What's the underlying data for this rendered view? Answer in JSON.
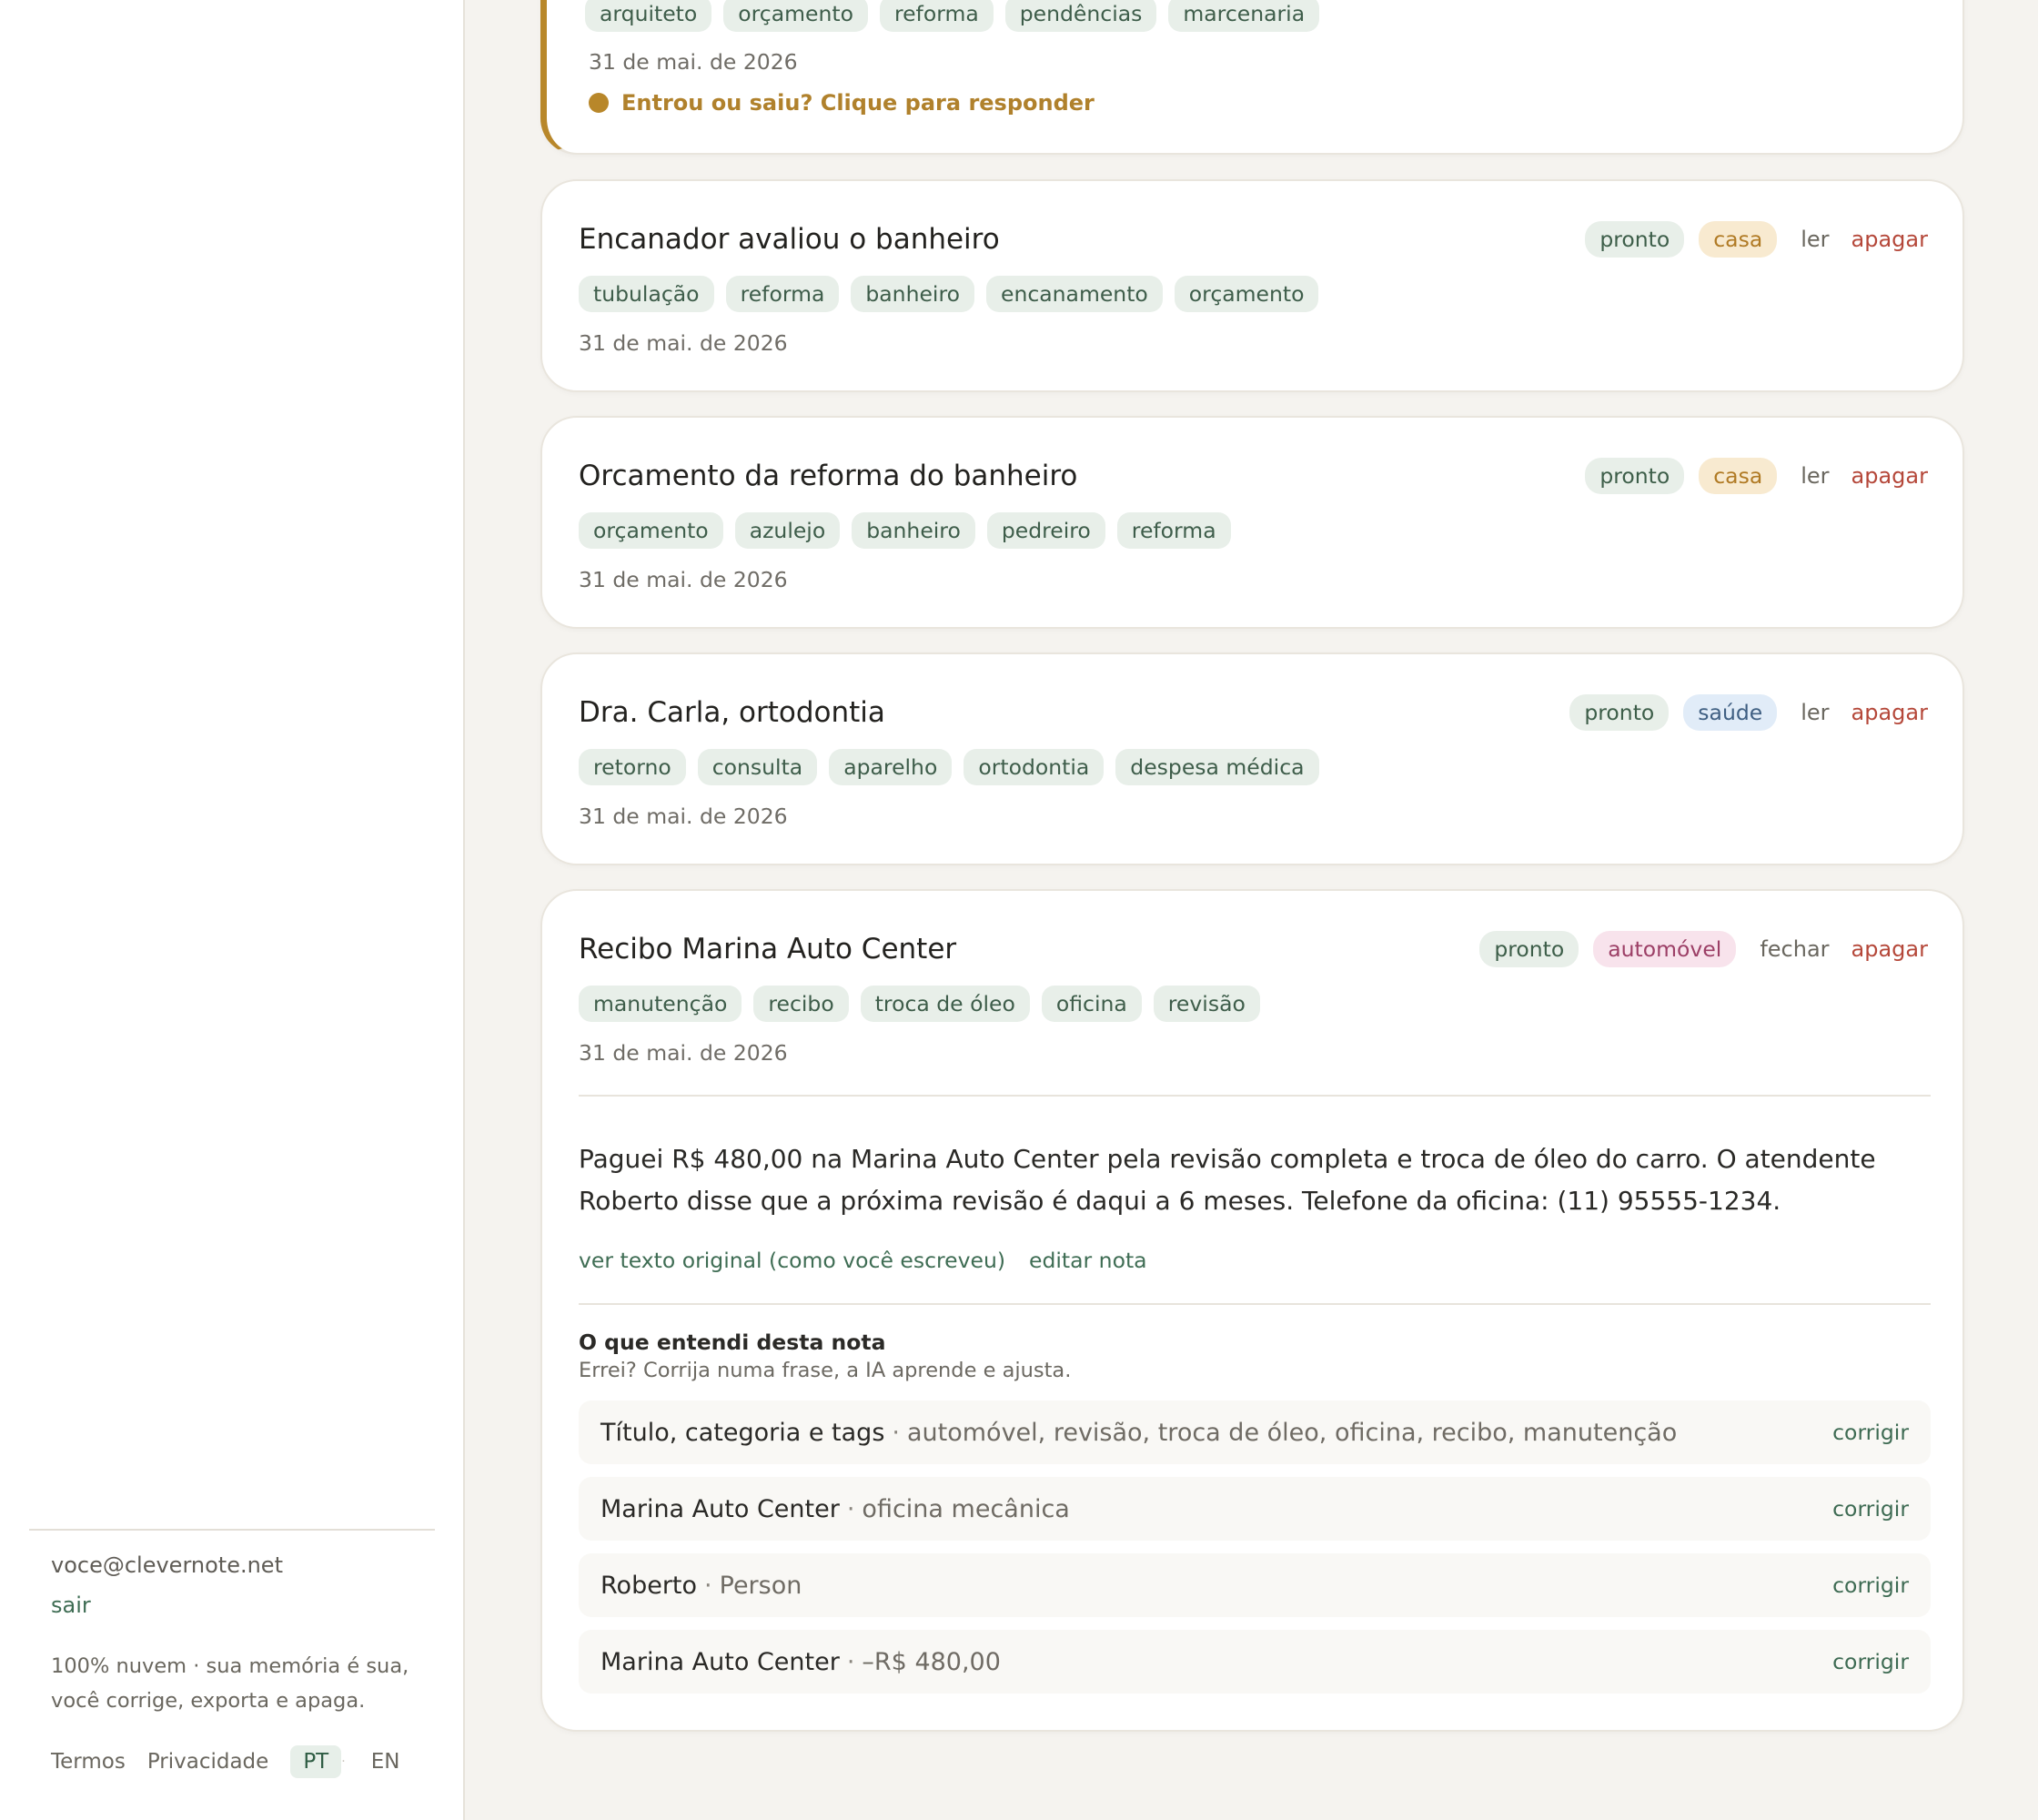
{
  "sidebar": {
    "email": "voce@clevernote.net",
    "signout": "sair",
    "tagline": "100% nuvem · sua memória é sua, você corrige, exporta e apaga.",
    "links": {
      "terms": "Termos",
      "privacy": "Privacidade"
    },
    "lang": {
      "pt": "PT",
      "sep": "·",
      "en": "EN",
      "active": "PT"
    }
  },
  "notes": {
    "pending": {
      "tags": [
        "arquiteto",
        "orçamento",
        "reforma",
        "pendências",
        "marcenaria"
      ],
      "date": "31 de mai. de 2026",
      "prompt": "Entrou ou saiu? Clique para responder"
    },
    "n1": {
      "title": "Encanador avaliou o banheiro",
      "status": "pronto",
      "category": "casa",
      "read": "ler",
      "delete": "apagar",
      "tags": [
        "tubulação",
        "reforma",
        "banheiro",
        "encanamento",
        "orçamento"
      ],
      "date": "31 de mai. de 2026"
    },
    "n2": {
      "title": "Orcamento da reforma do banheiro",
      "status": "pronto",
      "category": "casa",
      "read": "ler",
      "delete": "apagar",
      "tags": [
        "orçamento",
        "azulejo",
        "banheiro",
        "pedreiro",
        "reforma"
      ],
      "date": "31 de mai. de 2026"
    },
    "n3": {
      "title": "Dra. Carla, ortodontia",
      "status": "pronto",
      "category": "saúde",
      "read": "ler",
      "delete": "apagar",
      "tags": [
        "retorno",
        "consulta",
        "aparelho",
        "ortodontia",
        "despesa médica"
      ],
      "date": "31 de mai. de 2026"
    },
    "n4": {
      "title": "Recibo Marina Auto Center",
      "status": "pronto",
      "category": "automóvel",
      "close": "fechar",
      "delete": "apagar",
      "tags": [
        "manutenção",
        "recibo",
        "troca de óleo",
        "oficina",
        "revisão"
      ],
      "date": "31 de mai. de 2026",
      "body": "Paguei R$ 480,00 na Marina Auto Center pela revisão completa e troca de óleo do carro. O atendente Roberto disse que a próxima revisão é daqui a 6 meses. Telefone da oficina: (11) 95555-1234.",
      "view_original": "ver texto original (como você escreveu)",
      "edit": "editar nota",
      "understood_title": "O que entendi desta nota",
      "understood_sub": "Errei? Corrija numa frase, a IA aprende e ajusta.",
      "sep": "·",
      "fix_label": "corrigir",
      "facts": [
        {
          "main": "Título, categoria e tags",
          "detail": "automóvel, revisão, troca de óleo, oficina, recibo, manutenção"
        },
        {
          "main": "Marina Auto Center",
          "detail": "oficina mecânica"
        },
        {
          "main": "Roberto",
          "detail": "Person"
        },
        {
          "main": "Marina Auto Center",
          "detail": "–R$ 480,00"
        }
      ]
    }
  }
}
